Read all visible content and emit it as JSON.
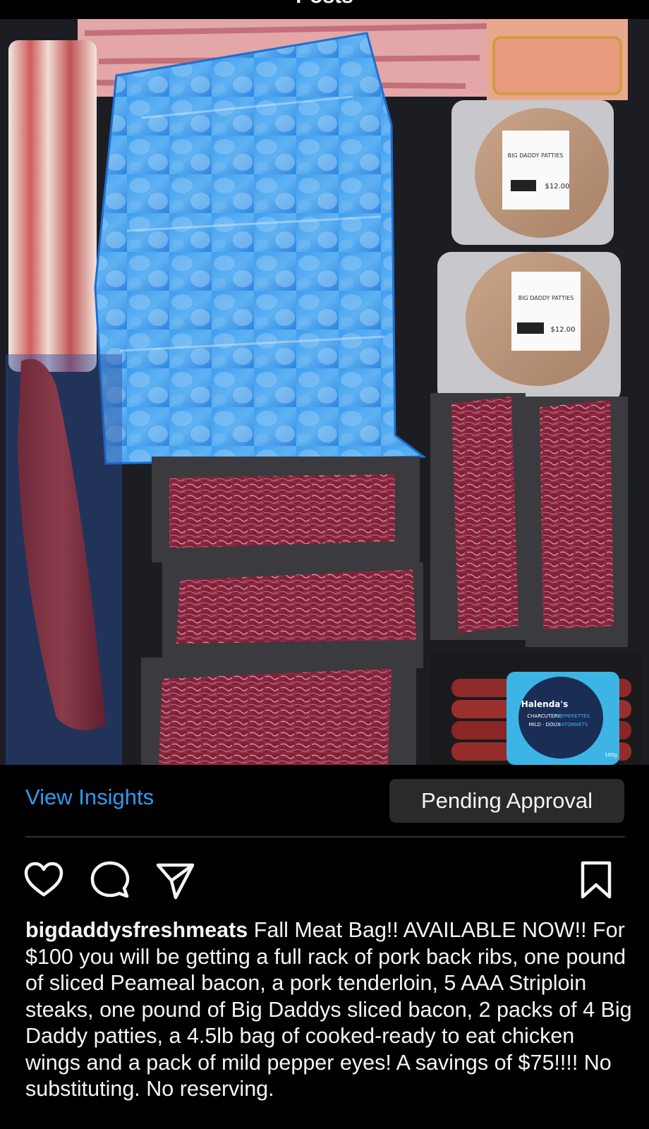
{
  "header": {
    "title": "Posts"
  },
  "post": {
    "image_alt": "Photo of vacuum-packed meat products: bacon, pork ribs, bag of chicken wings, burger patties, striploin steaks, pork tenderloin and pepperettes",
    "patty_label": {
      "brand": "BIG DADDY PATTIES",
      "price": "$12.00"
    },
    "pepperette_label": {
      "brand": "Halenda's",
      "line1": "CHARCUTERIE",
      "line2": "MILD · DOUX",
      "line3": "PEPPERETTES",
      "line4": "BATONNETS",
      "weight": "100g"
    },
    "insights_label": "View Insights",
    "status_button_label": "Pending Approval"
  },
  "actions": {
    "like": "heart-icon",
    "comment": "comment-icon",
    "share": "paper-plane-icon",
    "save": "bookmark-icon"
  },
  "caption": {
    "username": "bigdaddysfreshmeats",
    "text": "Fall Meat Bag!! AVAILABLE NOW!! For $100 you will be getting a full rack of pork back ribs, one pound of sliced Peameal bacon, a pork tenderloin, 5 AAA Striploin steaks, one pound of Big Daddys sliced bacon, 2 packs of 4 Big Daddy patties, a 4.5lb bag of cooked-ready to eat chicken wings and a pack of mild pepper eyes! A savings of $75!!!! No substituting.  No reserving."
  },
  "colors": {
    "background": "#000000",
    "link_blue": "#2f9bf0",
    "button_bg": "#2a2a2d",
    "text": "#f5f5f5"
  }
}
